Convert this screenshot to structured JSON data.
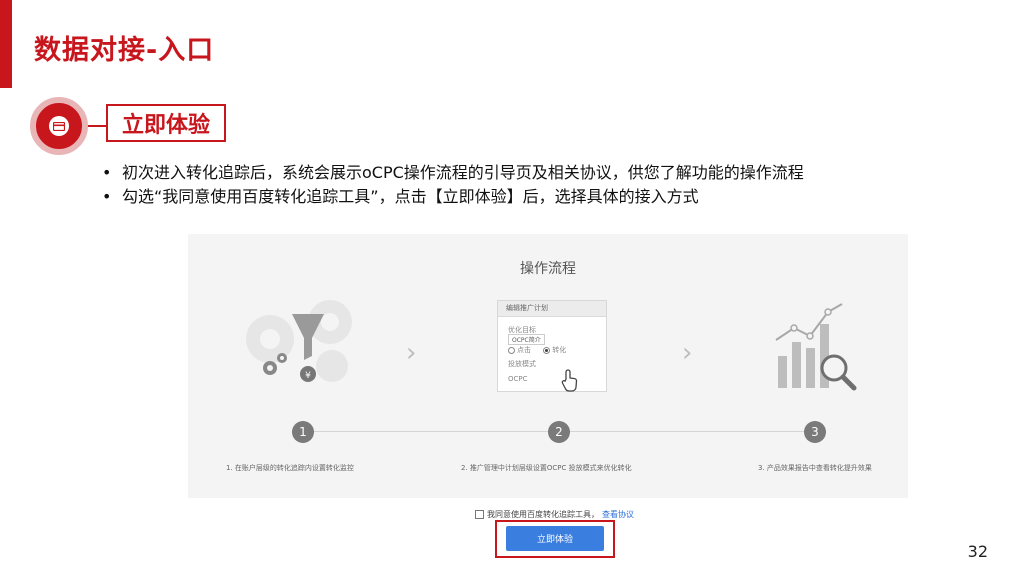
{
  "slide": {
    "title": "数据对接-入口",
    "section_label": "立即体验",
    "bullets": [
      "初次进入转化追踪后，系统会展示oCPC操作流程的引导页及相关协议，供您了解功能的操作流程",
      "勾选“我同意使用百度转化追踪工具”，点击【立即体验】后，选择具体的接入方式"
    ],
    "page_number": "32",
    "accent_color": "#c8161d"
  },
  "screenshot": {
    "flow_title": "操作流程",
    "card": {
      "header": "编辑推广计划",
      "goal_label": "优化目标",
      "tag": "OCPC简介",
      "option_1": "点击",
      "option_2": "转化",
      "mode_label": "投放模式",
      "mode_value": "OCPC"
    },
    "steps": [
      {
        "number": "1",
        "desc": "1. 在账户层级的转化追踪内设置转化监控"
      },
      {
        "number": "2",
        "desc": "2. 推广管理中计划层级设置OCPC 投放模式来优化转化"
      },
      {
        "number": "3",
        "desc": "3. 产品效果报告中查看转化提升效果"
      }
    ],
    "agreement_text": "我同意使用百度转化追踪工具，",
    "agreement_link": "查看协议",
    "try_button": "立即体验",
    "button_color": "#3a7ee0"
  }
}
